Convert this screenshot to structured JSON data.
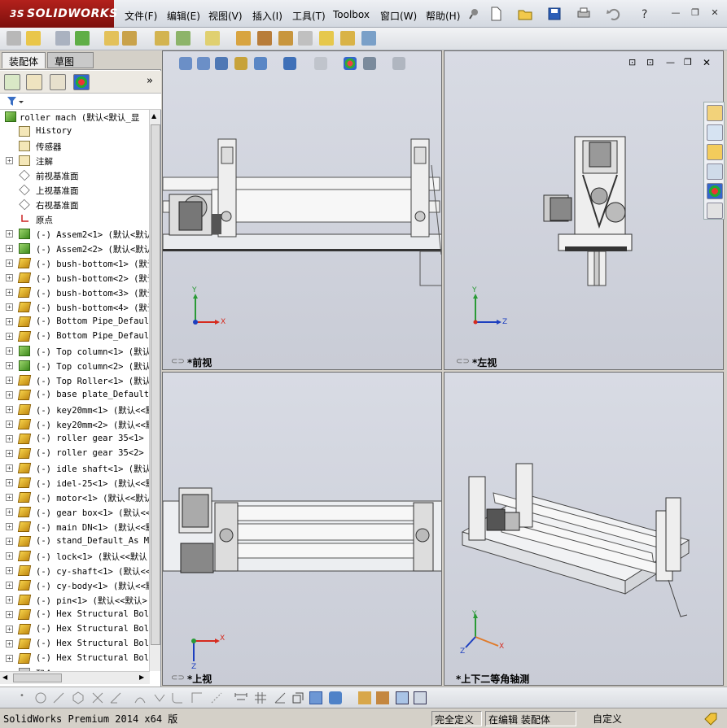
{
  "app": {
    "brand": "SOLIDWORKS",
    "ds_mark": "3S"
  },
  "menu": [
    "文件(F)",
    "编辑(E)",
    "视图(V)",
    "插入(I)",
    "工具(T)",
    "Toolbox",
    "窗口(W)",
    "帮助(H)"
  ],
  "left_panel": {
    "tabs": [
      "装配体",
      "草图"
    ],
    "root": "roller mach  (默认<默认_显",
    "items": [
      {
        "label": "History",
        "icon": "history-icon",
        "type": "folder"
      },
      {
        "label": "传感器",
        "icon": "sensor-icon",
        "type": "folder"
      },
      {
        "label": "注解",
        "icon": "annotation-icon",
        "type": "folder",
        "expand": true
      },
      {
        "label": "前视基准面",
        "icon": "plane-icon",
        "type": "plane"
      },
      {
        "label": "上视基准面",
        "icon": "plane-icon",
        "type": "plane"
      },
      {
        "label": "右视基准面",
        "icon": "plane-icon",
        "type": "plane"
      },
      {
        "label": "原点",
        "icon": "origin-icon",
        "type": "origin"
      },
      {
        "label": "(-) Assem2<1> (默认<默认",
        "type": "asm",
        "expand": true
      },
      {
        "label": "(-) Assem2<2> (默认<默认",
        "type": "asm",
        "expand": true
      },
      {
        "label": "(-) bush-bottom<1> (默认",
        "type": "part",
        "expand": true
      },
      {
        "label": "(-) bush-bottom<2> (默认",
        "type": "part",
        "expand": true
      },
      {
        "label": "(-) bush-bottom<3> (默认",
        "type": "part",
        "expand": true
      },
      {
        "label": "(-) bush-bottom<4> (默认",
        "type": "part",
        "expand": true
      },
      {
        "label": "(-) Bottom Pipe_Default",
        "type": "part",
        "expand": true
      },
      {
        "label": "(-) Bottom Pipe_Default",
        "type": "part",
        "expand": true
      },
      {
        "label": "(-) Top column<1> (默认",
        "type": "asm",
        "expand": true
      },
      {
        "label": "(-) Top column<2> (默认",
        "type": "asm",
        "expand": true
      },
      {
        "label": "(-) Top Roller<1> (默认",
        "type": "part",
        "expand": true
      },
      {
        "label": "(-) base plate_Default_",
        "type": "part",
        "expand": true
      },
      {
        "label": "(-) key20mm<1> (默认<<默",
        "type": "part",
        "expand": true
      },
      {
        "label": "(-) key20mm<2> (默认<<默",
        "type": "part",
        "expand": true
      },
      {
        "label": "(-) roller gear 35<1> (",
        "type": "part",
        "expand": true
      },
      {
        "label": "(-) roller gear 35<2> (",
        "type": "part",
        "expand": true
      },
      {
        "label": "(-) idle shaft<1> (默认",
        "type": "part",
        "expand": true
      },
      {
        "label": "(-) idel-25<1> (默认<<默",
        "type": "part",
        "expand": true
      },
      {
        "label": "(-) motor<1> (默认<<默认",
        "type": "part",
        "expand": true
      },
      {
        "label": "(-) gear box<1> (默认<<",
        "type": "part",
        "expand": true
      },
      {
        "label": "(-) main DN<1> (默认<<默",
        "type": "part",
        "expand": true
      },
      {
        "label": "(-) stand_Default_As Ma",
        "type": "part",
        "expand": true
      },
      {
        "label": "(-) lock<1> (默认<<默认",
        "type": "part",
        "expand": true
      },
      {
        "label": "(-) cy-shaft<1> (默认<<",
        "type": "part",
        "expand": true
      },
      {
        "label": "(-) cy-body<1> (默认<<默",
        "type": "part",
        "expand": true
      },
      {
        "label": "(-) pin<1> (默认<<默认>",
        "type": "part",
        "expand": true
      },
      {
        "label": "(-) Hex Structural Bolt",
        "type": "part",
        "expand": true
      },
      {
        "label": "(-) Hex Structural Bolt",
        "type": "part",
        "expand": true
      },
      {
        "label": "(-) Hex Structural Bolt",
        "type": "part",
        "expand": true
      },
      {
        "label": "(-) Hex Structural Bolt",
        "type": "part",
        "expand": true
      },
      {
        "label": "配合",
        "type": "mates"
      }
    ]
  },
  "viewports": {
    "front": "*前视",
    "left": "*左视",
    "top": "*上视",
    "iso": "*上下二等角轴测"
  },
  "axes": {
    "x": "X",
    "y": "Y",
    "z": "Z"
  },
  "status": {
    "product": "SolidWorks Premium 2014 x64 版",
    "definition": "完全定义",
    "editing": "在编辑 装配体",
    "custom": "自定义"
  },
  "colors": {
    "brand_red": "#9b1a16",
    "viewport_bg": "#d2d5de",
    "axis_x": "#d62a1e",
    "axis_y": "#2a9a36",
    "axis_z": "#1d3fbf"
  }
}
